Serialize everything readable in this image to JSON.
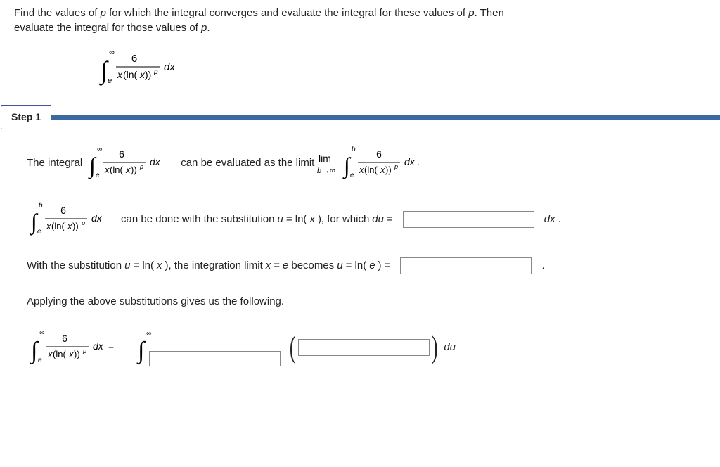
{
  "problem": {
    "line1": "Find the values of ",
    "var_p": "p",
    "line1b": " for which the integral converges and evaluate the integral for these values of ",
    "var_p2": "p",
    "line1c": ". Then",
    "line2": "evaluate the integral for those values of ",
    "var_p3": "p",
    "line2b": "."
  },
  "step": {
    "label": "Step 1"
  },
  "content": {
    "r1a": "The integral",
    "r1b": "can be evaluated as the limit",
    "r2a": "can be done with the substitution ",
    "r2b": "u",
    "r2c": " = ln(",
    "r2d": "x",
    "r2e": "), for which ",
    "r2f": "du",
    "r2g": " =",
    "r2h": "dx",
    "r2i": ".",
    "r3a": "With the substitution ",
    "r3b": "u",
    "r3c": " = ln(",
    "r3d": "x",
    "r3e": "), the integration limit ",
    "r3f": "x",
    "r3g": " = ",
    "r3h": "e",
    "r3i": " becomes ",
    "r3j": "u",
    "r3k": " = ln(",
    "r3l": "e",
    "r3m": ") =",
    "r3n": ".",
    "r4": "Applying the above substitutions gives us the following.",
    "r5a": "du"
  },
  "chart_data": {
    "type": "table",
    "integral_main": {
      "lower": "e",
      "upper": "∞",
      "numerator": "6",
      "denominator": "x(ln(x))^p",
      "differential": "dx"
    },
    "limit_expr": {
      "var": "b",
      "to": "∞",
      "lower": "e",
      "upper": "b"
    },
    "substitution": {
      "u_equals": "ln(x)",
      "du_equals_blank": true,
      "du_differential": "dx"
    },
    "limit_change": {
      "x_equals": "e",
      "u_equals": "ln(e)",
      "result_blank": true
    },
    "result_integral": {
      "lhs_lower": "e",
      "lhs_upper": "∞",
      "rhs_lower_blank": true,
      "rhs_upper": "∞",
      "integrand_blank": true,
      "differential": "du"
    }
  }
}
